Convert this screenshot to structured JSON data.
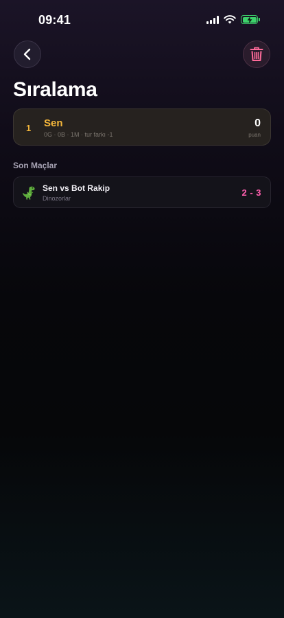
{
  "status_bar": {
    "time": "09:41",
    "icons": [
      "cellular-signal-icon",
      "wifi-icon",
      "battery-charging-icon"
    ],
    "battery_level": 1.0
  },
  "header": {
    "back_icon": "chevron-left-icon",
    "delete_icon": "trash-icon",
    "title": "Sıralama"
  },
  "standings": [
    {
      "rank": "1",
      "name": "Sen",
      "stats": "0G · 0B · 1M · tur farkı -1",
      "points": "0",
      "points_label": "puan"
    }
  ],
  "recent_matches": {
    "title": "Son Maçlar",
    "items": [
      {
        "icon": "dinosaur-icon",
        "title": "Sen vs Bot Rakip",
        "category": "Dinozorlar",
        "score": "2 - 3"
      }
    ]
  },
  "colors": {
    "accent_gold": "#f4b73b",
    "accent_pink": "#ff5fae",
    "trash_pink": "#ff6b9a",
    "battery_green": "#3dd26b"
  }
}
